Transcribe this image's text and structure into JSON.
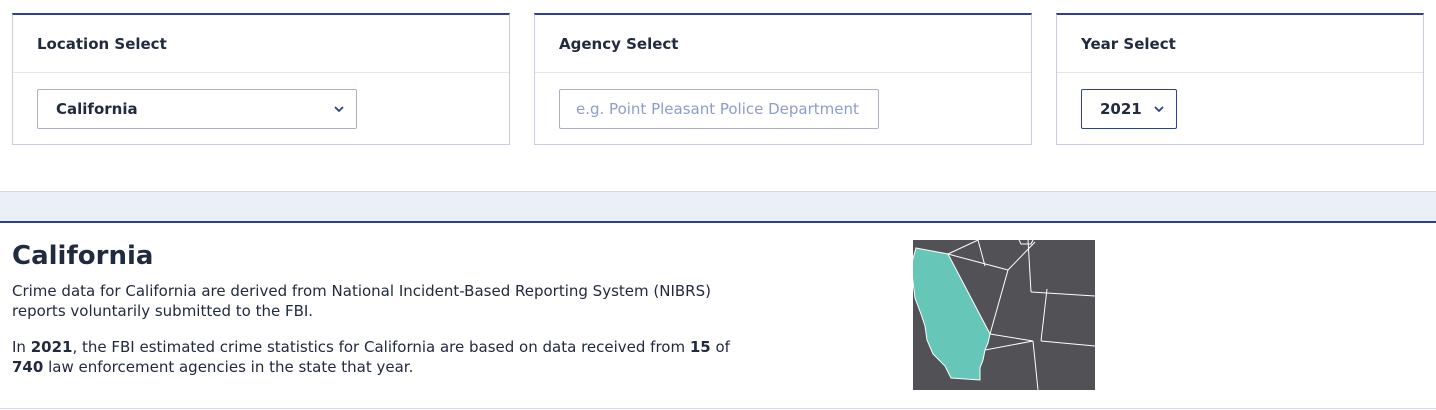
{
  "location_panel": {
    "title": "Location Select",
    "selected": "California"
  },
  "agency_panel": {
    "title": "Agency Select",
    "placeholder": "e.g. Point Pleasant Police Department"
  },
  "year_panel": {
    "title": "Year Select",
    "selected": "2021"
  },
  "state_section": {
    "title": "California",
    "description": "Crime data for California are derived from National Incident-Based Reporting System (NIBRS) reports voluntarily submitted to the FBI.",
    "stats": {
      "prefix": "In ",
      "year": "2021",
      "middle": ", the FBI estimated crime statistics for California are based on data received from ",
      "reporting": "15",
      "of_text": " of ",
      "total": "740",
      "suffix": " law enforcement agencies in the state that year."
    }
  },
  "map": {
    "highlight_color": "#66c6b8",
    "base_color": "#525156",
    "border_color": "#ffffff"
  },
  "colors": {
    "accent": "#2b3f9c",
    "text": "#212b3f",
    "placeholder": "#8e9ccc"
  }
}
